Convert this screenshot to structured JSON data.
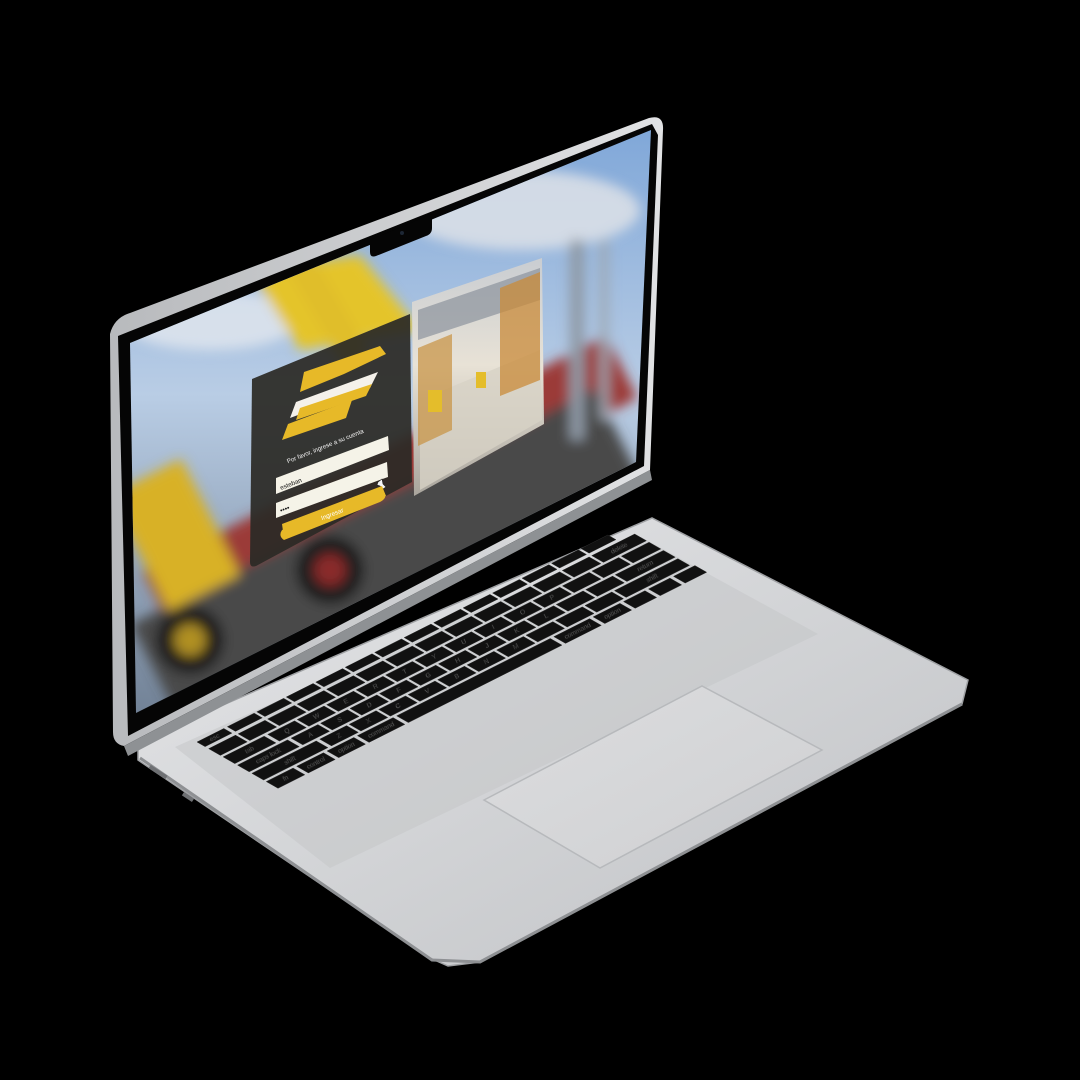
{
  "login": {
    "prompt": "Por favor, ingrese a su cuenta",
    "username_value": "esteban",
    "password_value": "••••",
    "submit_label": "Ingresar"
  },
  "keyboard": {
    "keys": [
      {
        "label": "esc"
      },
      {
        "label": "tab"
      },
      {
        "label": "caps lock"
      },
      {
        "label": "shift"
      },
      {
        "label": "fn"
      },
      {
        "label": "control"
      },
      {
        "label": "option"
      },
      {
        "label": "command"
      },
      {
        "label": "delete"
      },
      {
        "label": "return"
      },
      {
        "label": "shift"
      },
      {
        "label": "option"
      },
      {
        "label": "command"
      },
      {
        "label": "Q"
      },
      {
        "label": "W"
      },
      {
        "label": "E"
      },
      {
        "label": "R"
      },
      {
        "label": "T"
      },
      {
        "label": "Y"
      },
      {
        "label": "U"
      },
      {
        "label": "I"
      },
      {
        "label": "O"
      },
      {
        "label": "P"
      },
      {
        "label": "A"
      },
      {
        "label": "S"
      },
      {
        "label": "D"
      },
      {
        "label": "F"
      },
      {
        "label": "G"
      },
      {
        "label": "H"
      },
      {
        "label": "J"
      },
      {
        "label": "K"
      },
      {
        "label": "L"
      },
      {
        "label": "Z"
      },
      {
        "label": "X"
      },
      {
        "label": "C"
      },
      {
        "label": "V"
      },
      {
        "label": "B"
      },
      {
        "label": "N"
      },
      {
        "label": "M"
      }
    ]
  },
  "colors": {
    "accent": "#E7B928",
    "background": "#000000",
    "laptop_body": "#D7D8DA",
    "bezel": "#050505",
    "keycap": "#111111",
    "panel": "#2B2A26"
  },
  "icons": {
    "logo": "brand-logo-stripes",
    "cursor": "pointer-hand"
  }
}
